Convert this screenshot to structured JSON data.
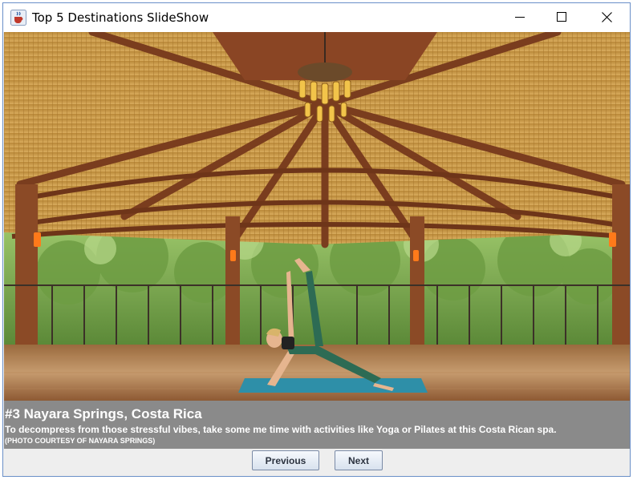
{
  "window": {
    "title": "Top 5 Destinations SlideShow",
    "app_icon": "java-cup-icon",
    "controls": {
      "minimize_icon": "minimize-icon",
      "maximize_icon": "maximize-icon",
      "close_icon": "close-icon"
    }
  },
  "slide": {
    "image_subject": "yoga pose on a mat in an open-air wooden pavilion with a thatched roof, chandelier and jungle trees",
    "caption_title": "#3 Nayara Springs, Costa Rica",
    "caption_text": "To decompress from those stressful vibes, take some me time with activities like Yoga or Pilates at this Costa Rican spa.",
    "caption_credit": "(PHOTO COURTESY OF NAYARA SPRINGS)"
  },
  "navigation": {
    "previous_label": "Previous",
    "next_label": "Next"
  },
  "colors": {
    "caption_bg": "#8a8a8a",
    "caption_text": "#ffffff",
    "window_border": "#6a8fc8"
  }
}
